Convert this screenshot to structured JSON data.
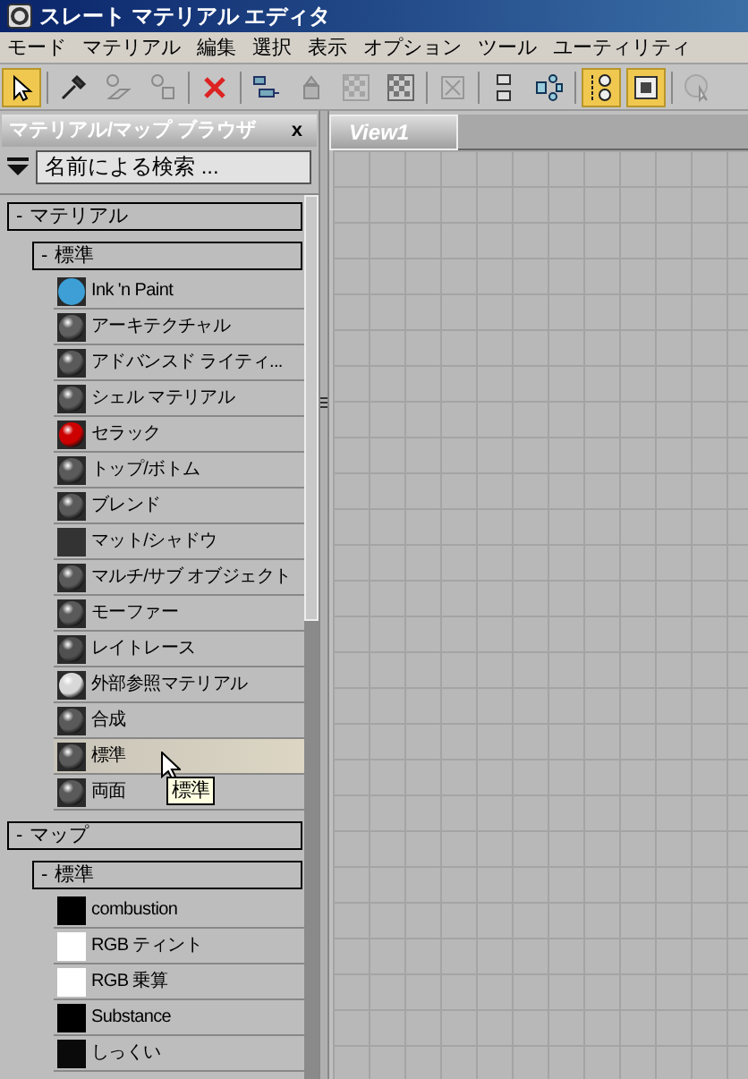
{
  "window": {
    "title": "スレート マテリアル エディタ"
  },
  "menu": [
    "モード",
    "マテリアル",
    "編集",
    "選択",
    "表示",
    "オプション",
    "ツール",
    "ユーティリティ"
  ],
  "toolbar": [
    {
      "kind": "button",
      "active": true,
      "disabled": false
    },
    {
      "kind": "separator"
    },
    {
      "kind": "button",
      "active": false,
      "disabled": false
    },
    {
      "kind": "button",
      "active": false,
      "disabled": true
    },
    {
      "kind": "button",
      "active": false,
      "disabled": true
    },
    {
      "kind": "separator"
    },
    {
      "kind": "button",
      "active": false,
      "disabled": false
    },
    {
      "kind": "separator"
    },
    {
      "kind": "button",
      "active": false,
      "disabled": false
    },
    {
      "kind": "button",
      "active": false,
      "disabled": true
    },
    {
      "kind": "button",
      "active": false,
      "disabled": true
    },
    {
      "kind": "button",
      "active": false,
      "disabled": false
    },
    {
      "kind": "separator"
    },
    {
      "kind": "button",
      "active": false,
      "disabled": true
    },
    {
      "kind": "separator"
    },
    {
      "kind": "button",
      "active": false,
      "disabled": false
    },
    {
      "kind": "button",
      "active": false,
      "disabled": false
    },
    {
      "kind": "separator"
    },
    {
      "kind": "button",
      "active": true,
      "disabled": false
    },
    {
      "kind": "button",
      "active": true,
      "disabled": false
    },
    {
      "kind": "separator"
    },
    {
      "kind": "button",
      "active": false,
      "disabled": true
    }
  ],
  "browser": {
    "title": "マテリアル/マップ ブラウザ",
    "close": "x",
    "search": {
      "placeholder": "名前による検索 ..."
    },
    "groups": [
      {
        "toggle": "-",
        "label": "マテリアル",
        "expanded": true,
        "children": [
          {
            "toggle": "-",
            "label": "標準",
            "expanded": true,
            "items": [
              {
                "label": "Ink 'n Paint",
                "kind": "disc",
                "color": "#3d9fd6",
                "hovered": false
              },
              {
                "label": "アーキテクチャル",
                "kind": "sphere",
                "color": "#606060",
                "hovered": false
              },
              {
                "label": "アドバンスド ライティ...",
                "kind": "sphere",
                "color": "#5a5a5a",
                "hovered": false
              },
              {
                "label": "シェル マテリアル",
                "kind": "sphere",
                "color": "#5a5a5a",
                "hovered": false
              },
              {
                "label": "セラック",
                "kind": "sphere",
                "color": "#cc0000",
                "hovered": false
              },
              {
                "label": "トップ/ボトム",
                "kind": "sphere",
                "color": "#5a5a5a",
                "hovered": false
              },
              {
                "label": "ブレンド",
                "kind": "sphere",
                "color": "#5a5a5a",
                "hovered": false
              },
              {
                "label": "マット/シャドウ",
                "kind": "square",
                "color": "#333333",
                "hovered": false
              },
              {
                "label": "マルチ/サブ オブジェクト",
                "kind": "sphere",
                "color": "#5a5a5a",
                "hovered": false
              },
              {
                "label": "モーファー",
                "kind": "sphere",
                "color": "#5a5a5a",
                "hovered": false
              },
              {
                "label": "レイトレース",
                "kind": "sphere",
                "color": "#505050",
                "hovered": false
              },
              {
                "label": "外部参照マテリアル",
                "kind": "sphere",
                "color": "#d8d8d8",
                "hovered": false
              },
              {
                "label": "合成",
                "kind": "sphere",
                "color": "#5a5a5a",
                "hovered": false
              },
              {
                "label": "標準",
                "kind": "sphere",
                "color": "#5a5a5a",
                "hovered": true
              },
              {
                "label": "両面",
                "kind": "sphere",
                "color": "#5a5a5a",
                "hovered": false
              }
            ]
          }
        ]
      },
      {
        "toggle": "-",
        "label": "マップ",
        "expanded": true,
        "children": [
          {
            "toggle": "-",
            "label": "標準",
            "expanded": true,
            "items": [
              {
                "label": "combustion",
                "kind": "square",
                "color": "#000000",
                "hovered": false
              },
              {
                "label": "RGB ティント",
                "kind": "square",
                "color": "#ffffff",
                "hovered": false
              },
              {
                "label": "RGB 乗算",
                "kind": "square",
                "color": "#ffffff",
                "hovered": false
              },
              {
                "label": "Substance",
                "kind": "square",
                "color": "#000000",
                "hovered": false
              },
              {
                "label": "しっくい",
                "kind": "square",
                "color": "#0a0a0a",
                "hovered": false
              }
            ]
          }
        ]
      }
    ]
  },
  "tooltip": "標準",
  "view": {
    "tabs": [
      {
        "label": "View1",
        "selected": true
      }
    ]
  }
}
